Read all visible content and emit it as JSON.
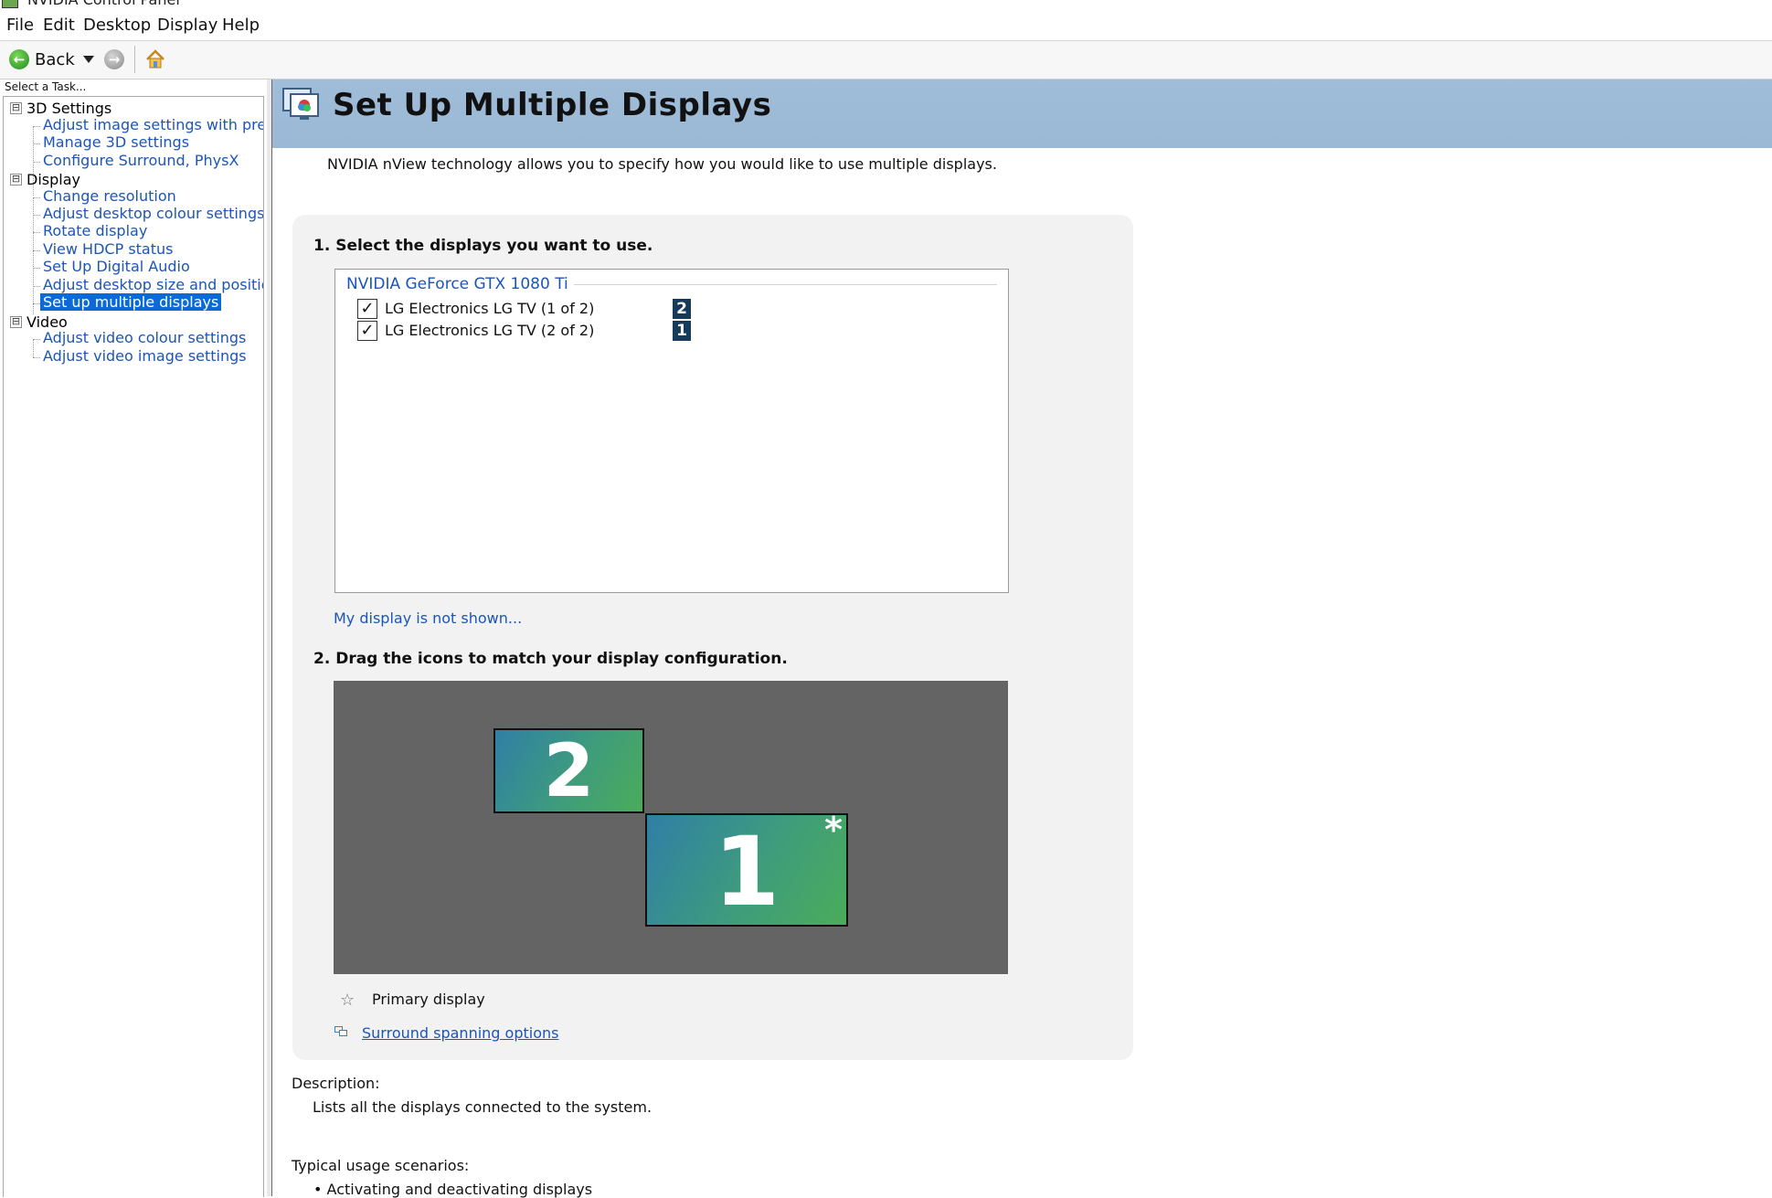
{
  "window": {
    "title": "NVIDIA Control Panel"
  },
  "menu": {
    "file": "File",
    "edit": "Edit",
    "desktop": "Desktop",
    "display": "Display",
    "help": "Help"
  },
  "toolbar": {
    "back_label": "Back"
  },
  "sidebar": {
    "select_task": "Select a Task...",
    "cat_3d": "3D Settings",
    "item_adjust_image": "Adjust image settings with preview",
    "item_manage_3d": "Manage 3D settings",
    "item_surround": "Configure Surround, PhysX",
    "cat_display": "Display",
    "item_change_resolution": "Change resolution",
    "item_desktop_colour": "Adjust desktop colour settings",
    "item_rotate": "Rotate display",
    "item_hdcp": "View HDCP status",
    "item_digital_audio": "Set Up Digital Audio",
    "item_desktop_size": "Adjust desktop size and position",
    "item_multiple_displays": "Set up multiple displays",
    "cat_video": "Video",
    "item_video_colour": "Adjust video colour settings",
    "item_video_image": "Adjust video image settings",
    "expand_glyph": "⊟"
  },
  "main": {
    "title": "Set Up Multiple Displays",
    "intro": "NVIDIA nView technology allows you to specify how you would like to use multiple displays.",
    "step1": "1. Select the displays you want to use.",
    "gpu_name": "NVIDIA GeForce GTX 1080 Ti",
    "displays": [
      {
        "label": "LG Electronics LG TV (1 of 2)",
        "number": "2",
        "checked": true
      },
      {
        "label": "LG Electronics LG TV (2 of 2)",
        "number": "1",
        "checked": true
      }
    ],
    "check_glyph": "✓",
    "not_shown_link": "My display is not shown...",
    "step2": "2. Drag the icons to match your display configuration.",
    "monitor_2": "2",
    "monitor_1": "1",
    "primary_star": "*",
    "primary_legend": "Primary display",
    "legend_star_glyph": "☆",
    "surround_link": "Surround spanning options",
    "description_heading": "Description:",
    "description_text": "Lists all the displays connected to the system.",
    "usage_heading": "Typical usage scenarios:",
    "usage_item": "• Activating and deactivating displays"
  },
  "colors": {
    "accent_blue": "#1c55b8",
    "header_band": "#9fbcd8",
    "selection": "#0b6ad6",
    "arrange_bg": "#646464"
  }
}
